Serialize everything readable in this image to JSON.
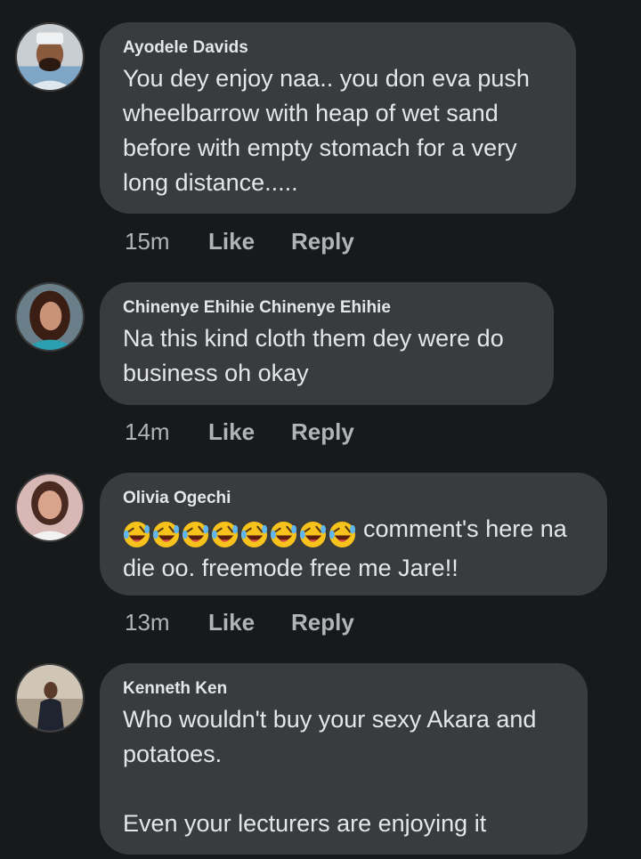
{
  "comments": [
    {
      "author": "Ayodele Davids",
      "text": "You dey enjoy naa.. you don eva push wheelbarrow with heap of wet sand before with empty stomach for a very long distance.....",
      "time": "15m",
      "like_label": "Like",
      "reply_label": "Reply"
    },
    {
      "author": "Chinenye Ehihie Chinenye Ehihie",
      "text": "Na this kind cloth them dey were do business   oh okay",
      "time": "14m",
      "like_label": "Like",
      "reply_label": "Reply"
    },
    {
      "author": "Olivia Ogechi",
      "emoji": "rolling-on-floor-laughing-icon",
      "emoji_count": 8,
      "text": "comment's here na die oo. freemode free me Jare!!",
      "time": "13m",
      "like_label": "Like",
      "reply_label": "Reply"
    },
    {
      "author": "Kenneth Ken",
      "text": "Who wouldn't buy your sexy Akara and potatoes.\n\nEven your lecturers are enjoying it"
    }
  ],
  "colors": {
    "background": "#18191a",
    "bubble": "#3a3b3c",
    "primary_text": "#e4e6eb",
    "secondary_text": "#b0b3b8"
  }
}
